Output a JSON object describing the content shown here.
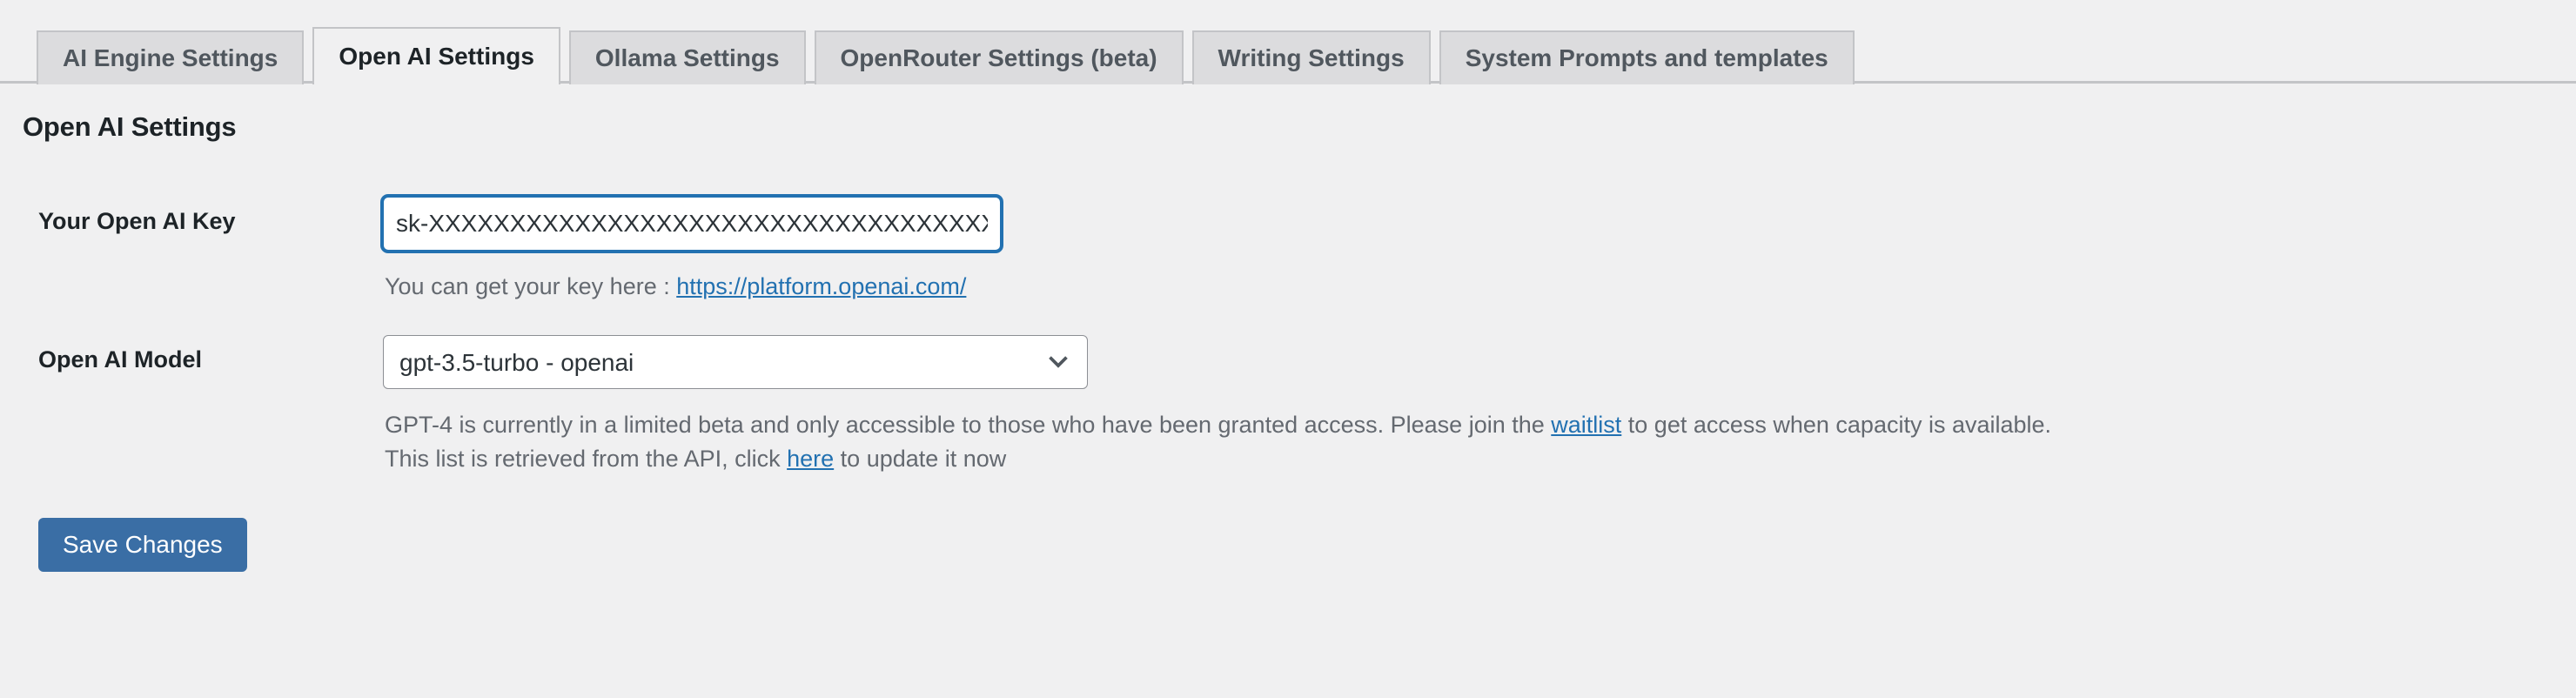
{
  "tabs": [
    {
      "label": "AI Engine Settings",
      "active": false
    },
    {
      "label": "Open AI Settings",
      "active": true
    },
    {
      "label": "Ollama Settings",
      "active": false
    },
    {
      "label": "OpenRouter Settings (beta)",
      "active": false
    },
    {
      "label": "Writing Settings",
      "active": false
    },
    {
      "label": "System Prompts and templates",
      "active": false
    }
  ],
  "page": {
    "title": "Open AI Settings"
  },
  "fields": {
    "api_key": {
      "label": "Your Open AI Key",
      "value": "sk-XXXXXXXXXXXXXXXXXXXXXXXXXXXXXXXXXXXXXXXXXXXXXX",
      "placeholder": "",
      "description_prefix": "You can get your key here : ",
      "description_link_text": "https://platform.openai.com/"
    },
    "model": {
      "label": "Open AI Model",
      "selected": "gpt-3.5-turbo - openai",
      "options": [
        "gpt-3.5-turbo - openai"
      ],
      "chevron_icon": "chevron-down-icon",
      "description_line1_part1": "GPT-4 is currently in a limited beta and only accessible to those who have been granted access. Please join the ",
      "description_line1_link": "waitlist",
      "description_line1_part2": " to get access when capacity is available.",
      "description_line2_part1": "This list is retrieved from the API, click ",
      "description_line2_link": "here",
      "description_line2_part2": " to update it now"
    }
  },
  "actions": {
    "save_label": "Save Changes"
  },
  "colors": {
    "accent": "#2271b1",
    "button": "#3a6ea5",
    "link": "#2271b1",
    "page_bg": "#f0f0f1",
    "tab_inactive_bg": "#dcdcde",
    "border": "#c3c4c7"
  }
}
